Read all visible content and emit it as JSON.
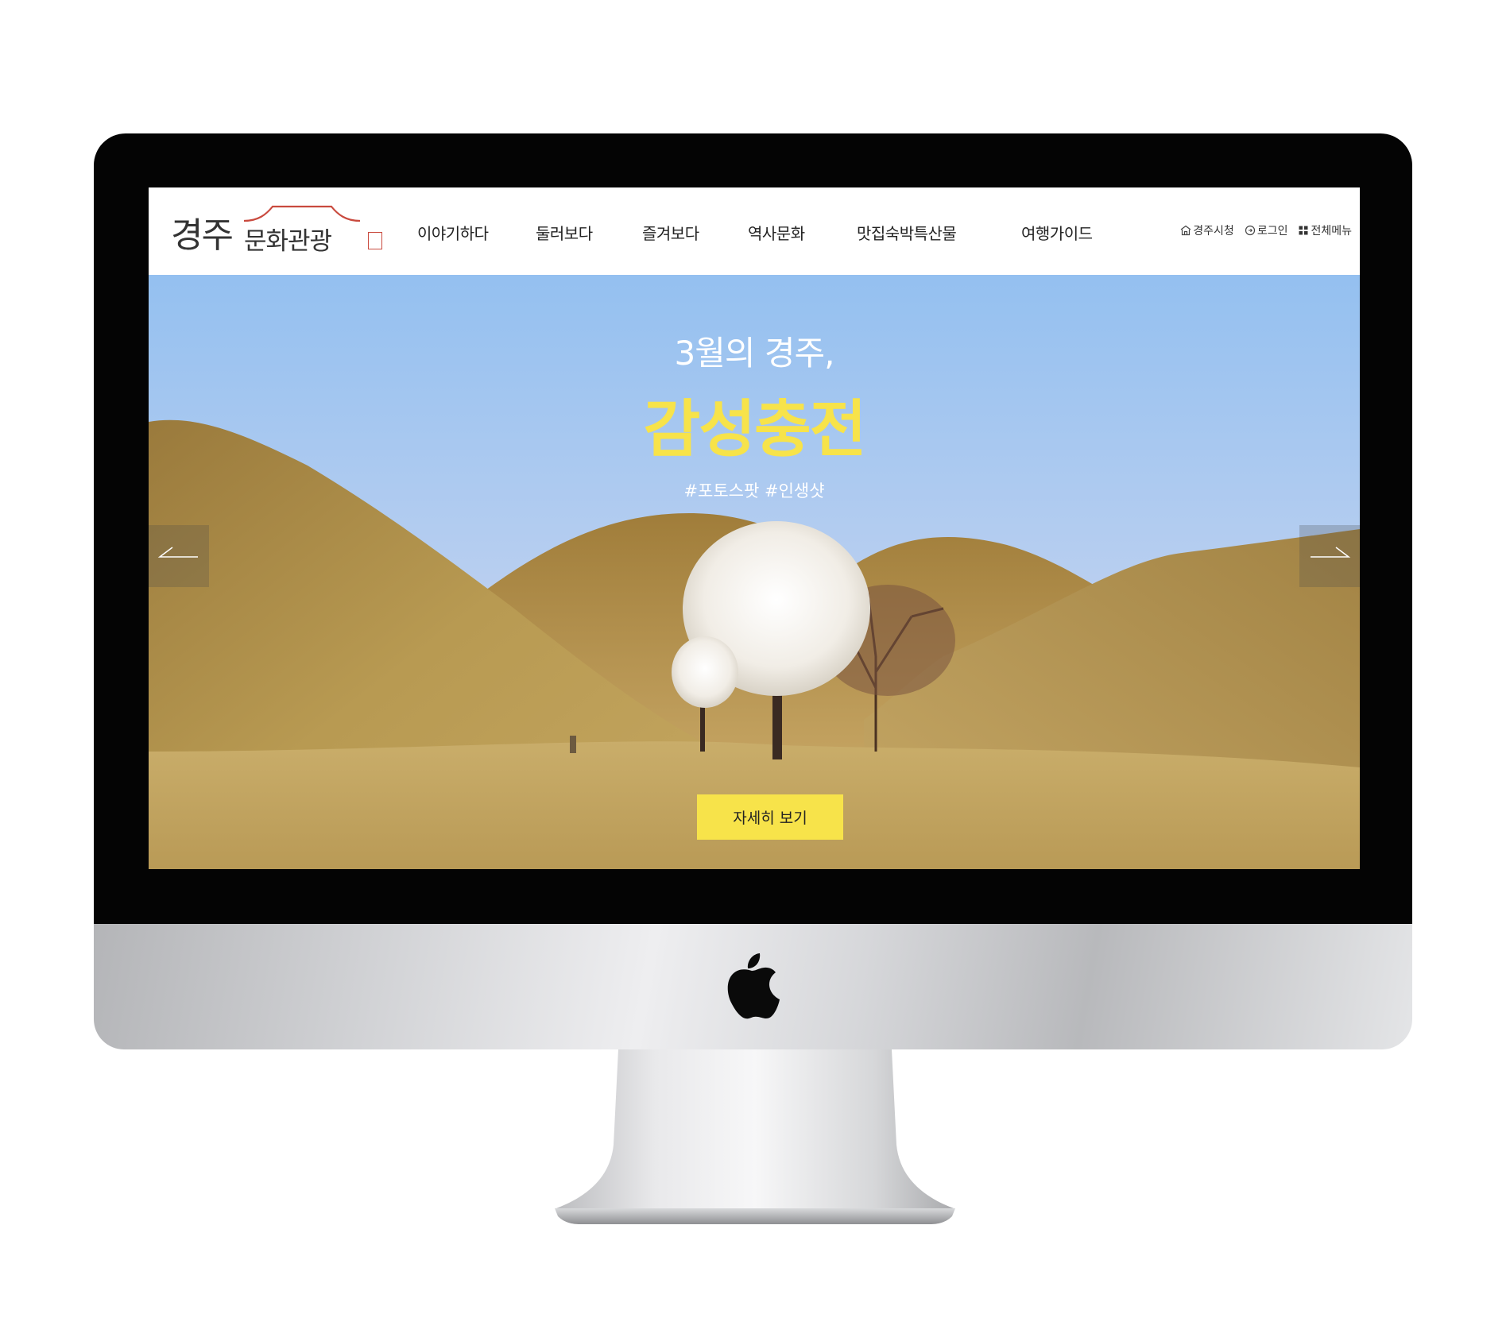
{
  "site": {
    "logo": {
      "main": "경주",
      "sub": "문화관광"
    },
    "nav": [
      "이야기하다",
      "둘러보다",
      "즐겨보다",
      "역사문화",
      "맛집숙박특산물",
      "여행가이드"
    ],
    "util": [
      {
        "label": "경주시청",
        "icon": "building-icon"
      },
      {
        "label": "로그인",
        "icon": "login-circle-icon"
      },
      {
        "label": "전체메뉴",
        "icon": "grid-icon"
      }
    ]
  },
  "hero": {
    "subtitle": "3월의 경주,",
    "title": "감성충전",
    "hashtags": "#포토스팟 #인생샷",
    "button": "자세히 보기",
    "prev_icon": "arrow-left-icon",
    "next_icon": "arrow-right-icon"
  },
  "colors": {
    "accent_yellow": "#f7e34a",
    "logo_red": "#c94a3e"
  }
}
